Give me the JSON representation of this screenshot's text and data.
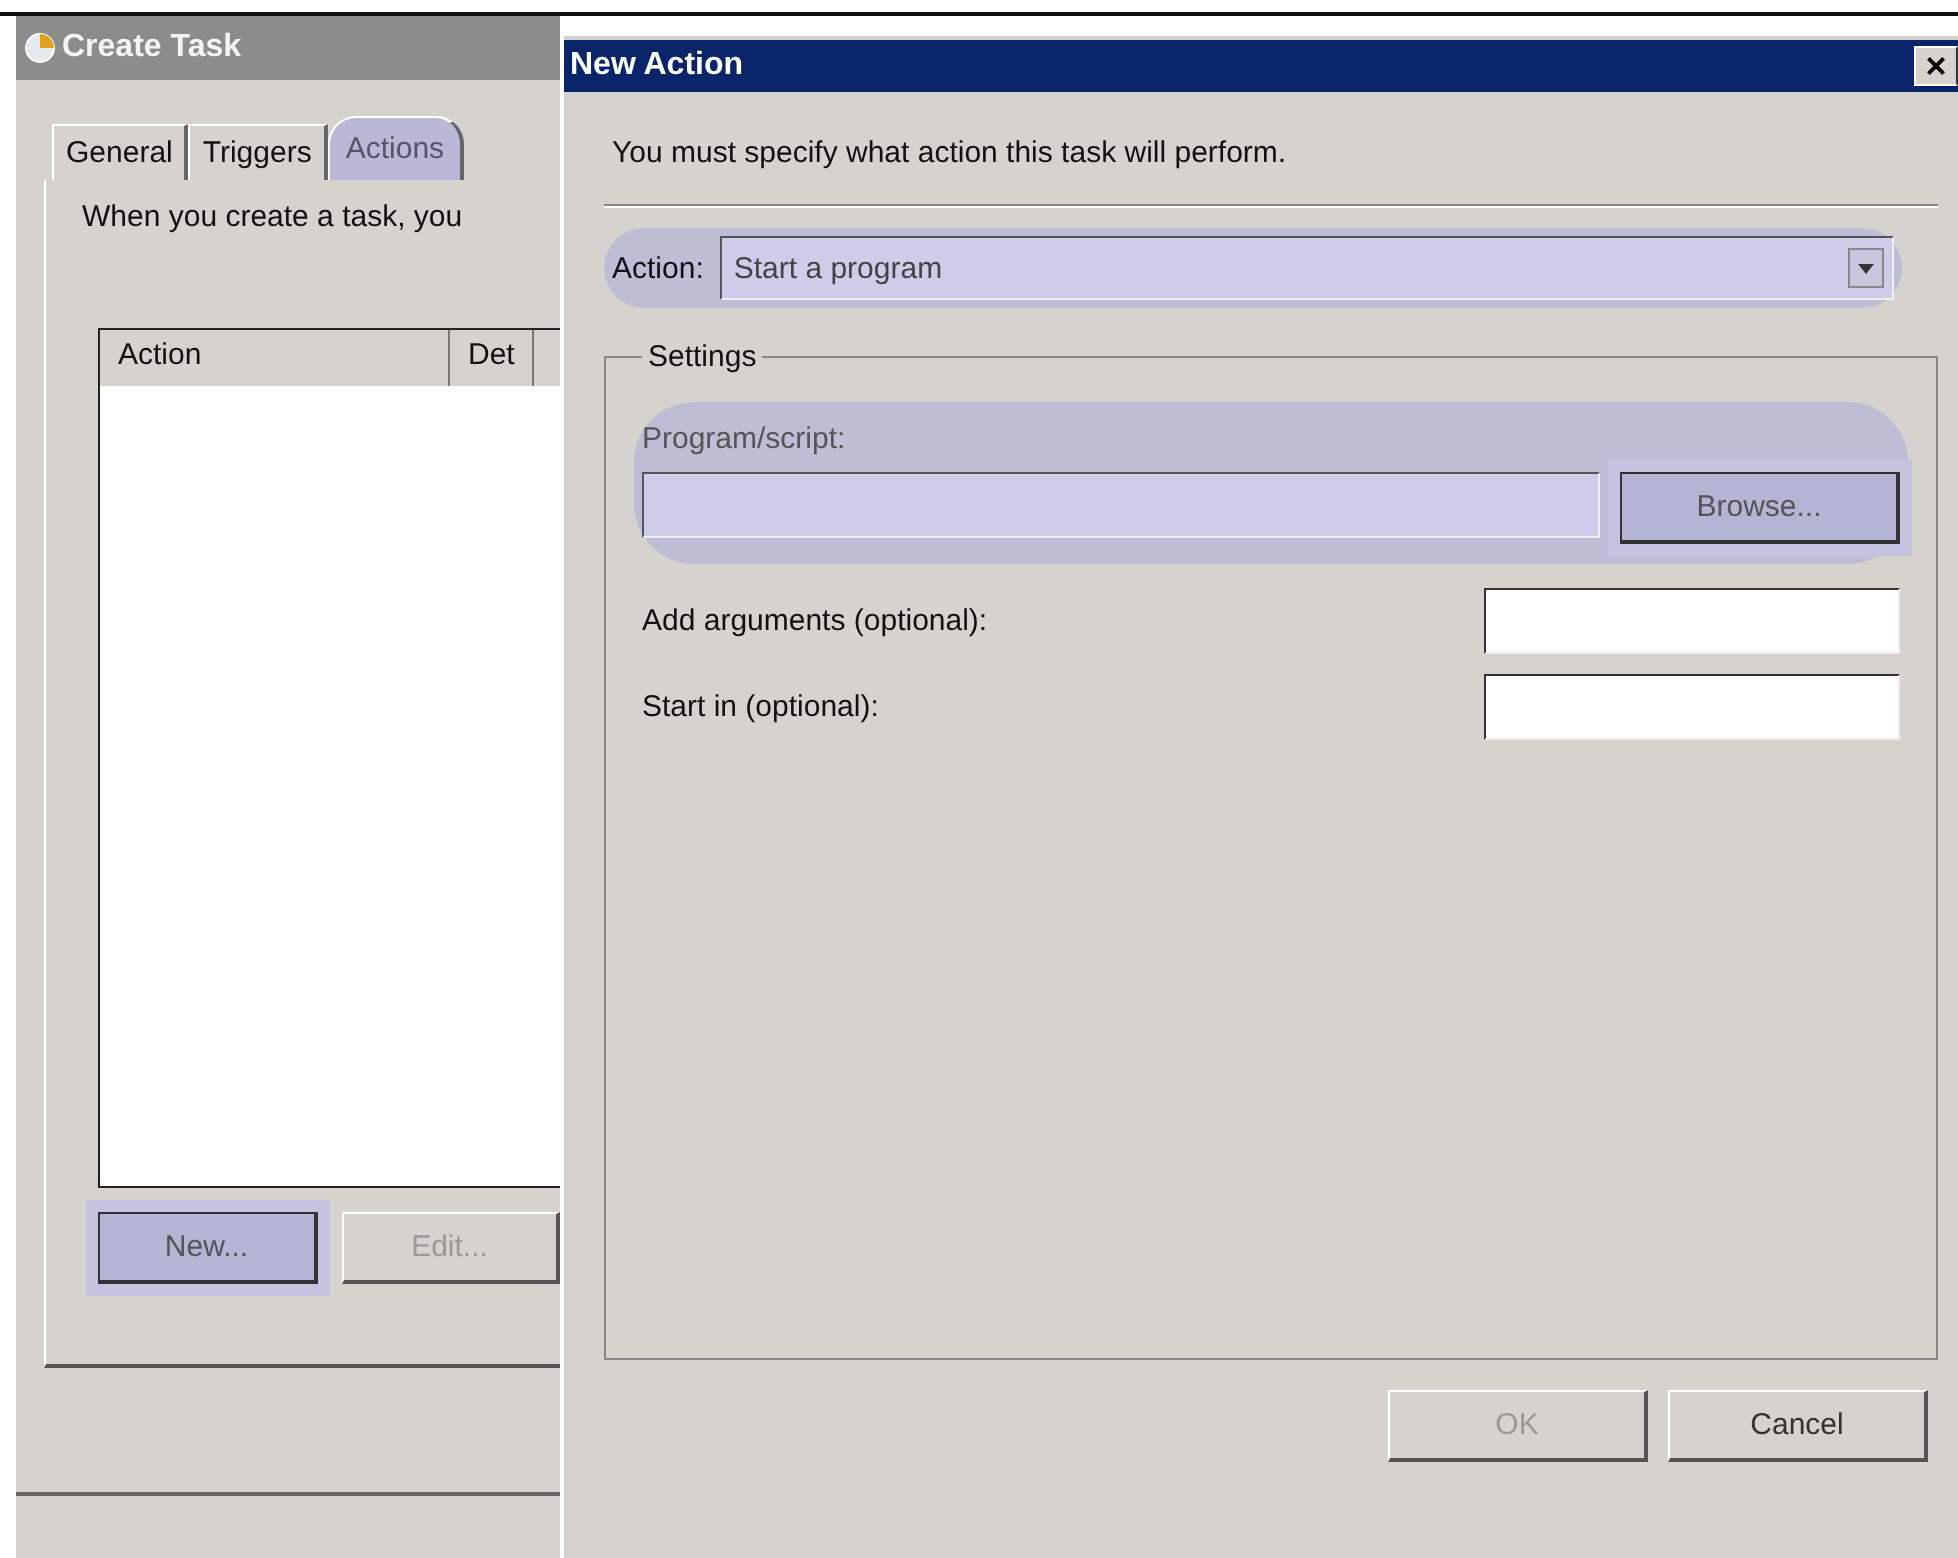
{
  "back_window": {
    "title": "Create Task",
    "tabs": [
      {
        "label": "General",
        "selected": false,
        "highlighted": false
      },
      {
        "label": "Triggers",
        "selected": false,
        "highlighted": false
      },
      {
        "label": "Actions",
        "selected": true,
        "highlighted": true
      }
    ],
    "intro": "When you create a task, you",
    "table": {
      "columns": [
        "Action",
        "Det"
      ]
    },
    "buttons": [
      {
        "label": "New...",
        "disabled": false,
        "highlighted": true
      },
      {
        "label": "Edit...",
        "disabled": true,
        "highlighted": false
      }
    ]
  },
  "dialog": {
    "title": "New Action",
    "close": "×",
    "instruction": "You must specify what action this task will perform.",
    "action": {
      "label": "Action:",
      "value": "Start a program",
      "highlighted": true
    },
    "settings": {
      "legend": "Settings",
      "program": {
        "label": "Program/script:",
        "button": "Browse...",
        "highlighted": true
      },
      "fields": [
        {
          "label": "Add arguments (optional):"
        },
        {
          "label": "Start in (optional):"
        }
      ]
    },
    "buttons": [
      {
        "label": "OK",
        "disabled": true
      },
      {
        "label": "Cancel",
        "disabled": false
      }
    ]
  }
}
